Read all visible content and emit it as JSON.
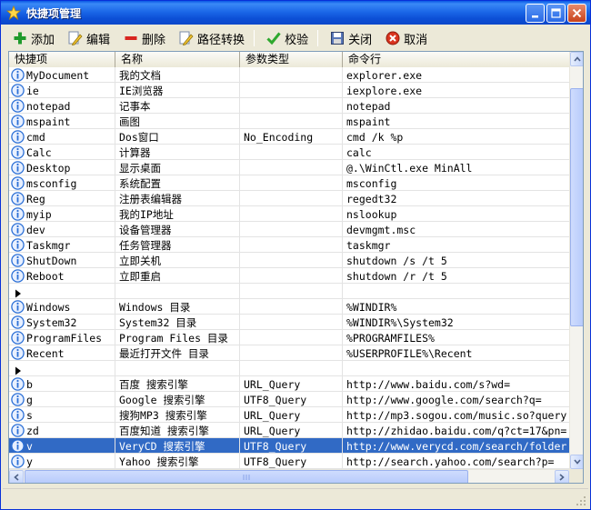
{
  "window": {
    "title": "快捷项管理"
  },
  "toolbar": [
    {
      "name": "add-button",
      "icon": "plus-icon",
      "label": "添加"
    },
    {
      "name": "edit-button",
      "icon": "pencil-icon",
      "label": "编辑"
    },
    {
      "name": "delete-button",
      "icon": "minus-icon",
      "label": "删除"
    },
    {
      "name": "path-convert-button",
      "icon": "pencil-path-icon",
      "label": "路径转换"
    },
    {
      "name": "verify-button",
      "icon": "checkmark-icon",
      "label": "校验"
    },
    {
      "name": "close-button",
      "icon": "floppy-icon",
      "label": "关闭"
    },
    {
      "name": "cancel-button",
      "icon": "cancel-icon",
      "label": "取消"
    }
  ],
  "columns": [
    "快捷项",
    "名称",
    "参数类型",
    "命令行"
  ],
  "rows": [
    {
      "type": "item",
      "key": "MyDocument",
      "name": "我的文档",
      "param": "",
      "cmd": "explorer.exe"
    },
    {
      "type": "item",
      "key": "ie",
      "name": "IE浏览器",
      "param": "",
      "cmd": "iexplore.exe"
    },
    {
      "type": "item",
      "key": "notepad",
      "name": "记事本",
      "param": "",
      "cmd": "notepad"
    },
    {
      "type": "item",
      "key": "mspaint",
      "name": "画图",
      "param": "",
      "cmd": "mspaint"
    },
    {
      "type": "item",
      "key": "cmd",
      "name": "Dos窗口",
      "param": "No_Encoding",
      "cmd": "cmd /k %p"
    },
    {
      "type": "item",
      "key": "Calc",
      "name": "计算器",
      "param": "",
      "cmd": "calc"
    },
    {
      "type": "item",
      "key": "Desktop",
      "name": "显示桌面",
      "param": "",
      "cmd": "@.\\WinCtl.exe MinAll"
    },
    {
      "type": "item",
      "key": "msconfig",
      "name": "系统配置",
      "param": "",
      "cmd": "msconfig"
    },
    {
      "type": "item",
      "key": "Reg",
      "name": "注册表编辑器",
      "param": "",
      "cmd": "regedt32"
    },
    {
      "type": "item",
      "key": "myip",
      "name": "我的IP地址",
      "param": "",
      "cmd": "nslookup"
    },
    {
      "type": "item",
      "key": "dev",
      "name": "设备管理器",
      "param": "",
      "cmd": "devmgmt.msc"
    },
    {
      "type": "item",
      "key": "Taskmgr",
      "name": "任务管理器",
      "param": "",
      "cmd": "taskmgr"
    },
    {
      "type": "item",
      "key": "ShutDown",
      "name": "立即关机",
      "param": "",
      "cmd": "shutdown /s /t 5"
    },
    {
      "type": "item",
      "key": "Reboot",
      "name": "立即重启",
      "param": "",
      "cmd": "shutdown /r /t 5"
    },
    {
      "type": "separator",
      "key": "",
      "name": "",
      "param": "",
      "cmd": ""
    },
    {
      "type": "item",
      "key": "Windows",
      "name": "Windows 目录",
      "param": "",
      "cmd": "%WINDIR%"
    },
    {
      "type": "item",
      "key": "System32",
      "name": "System32 目录",
      "param": "",
      "cmd": "%WINDIR%\\System32"
    },
    {
      "type": "item",
      "key": "ProgramFiles",
      "name": "Program Files 目录",
      "param": "",
      "cmd": "%PROGRAMFILES%"
    },
    {
      "type": "item",
      "key": "Recent",
      "name": "最近打开文件 目录",
      "param": "",
      "cmd": "%USERPROFILE%\\Recent"
    },
    {
      "type": "separator",
      "key": "",
      "name": "",
      "param": "",
      "cmd": ""
    },
    {
      "type": "item",
      "key": "b",
      "name": "百度 搜索引擎",
      "param": "URL_Query",
      "cmd": "http://www.baidu.com/s?wd="
    },
    {
      "type": "item",
      "key": "g",
      "name": "Google 搜索引擎",
      "param": "UTF8_Query",
      "cmd": "http://www.google.com/search?q="
    },
    {
      "type": "item",
      "key": "s",
      "name": "搜狗MP3 搜索引擎",
      "param": "URL_Query",
      "cmd": "http://mp3.sogou.com/music.so?query"
    },
    {
      "type": "item",
      "key": "zd",
      "name": "百度知道 搜索引擎",
      "param": "URL_Query",
      "cmd": "http://zhidao.baidu.com/q?ct=17&pn="
    },
    {
      "type": "item",
      "key": "v",
      "name": "VeryCD 搜索引擎",
      "param": "UTF8_Query",
      "cmd": "http://www.verycd.com/search/folder",
      "selected": true
    },
    {
      "type": "item",
      "key": "y",
      "name": "Yahoo 搜索引擎",
      "param": "UTF8_Query",
      "cmd": "http://search.yahoo.com/search?p="
    }
  ],
  "colors": {
    "selection": "#316ac5",
    "titlebar": "#0c4fd6",
    "info_icon": "#2b6fd6"
  }
}
